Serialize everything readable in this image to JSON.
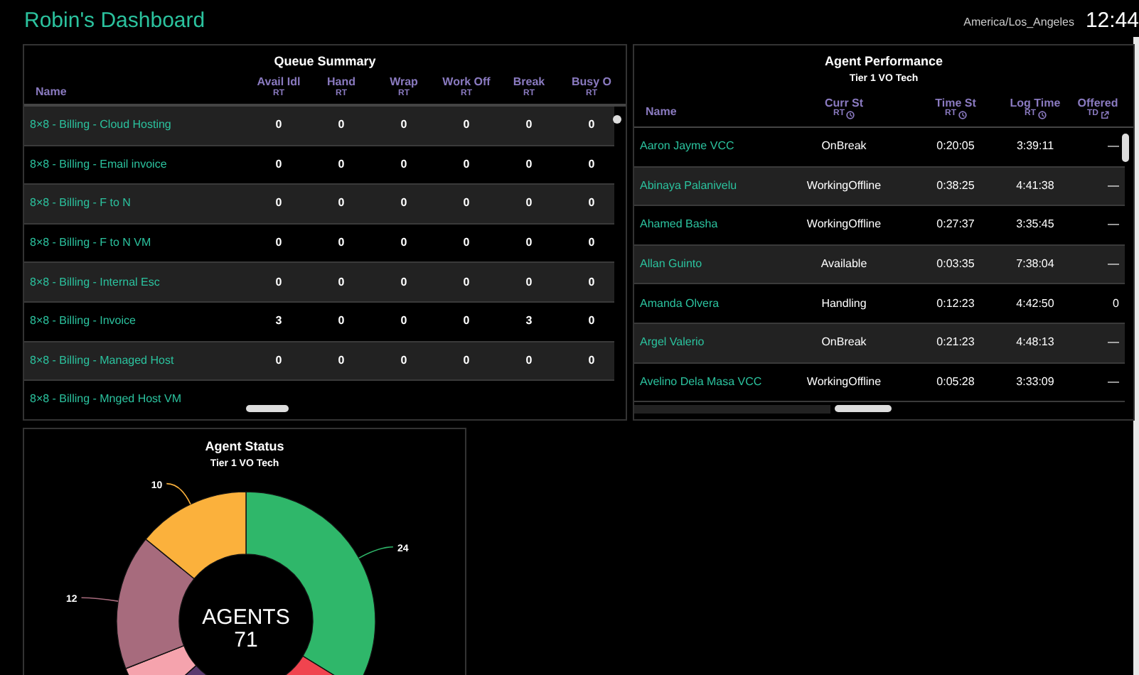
{
  "header": {
    "title": "Robin's Dashboard",
    "timezone": "America/Los_Angeles",
    "clock": "12:44"
  },
  "queue_summary": {
    "title": "Queue Summary",
    "columns": [
      {
        "label": "Name"
      },
      {
        "label": "Avail Idl",
        "sub": "RT"
      },
      {
        "label": "Hand",
        "sub": "RT"
      },
      {
        "label": "Wrap",
        "sub": "RT"
      },
      {
        "label": "Work Off",
        "sub": "RT"
      },
      {
        "label": "Break",
        "sub": "RT"
      },
      {
        "label": "Busy O",
        "sub": "RT"
      }
    ],
    "rows": [
      {
        "cells": [
          "8×8 - Billing - Cloud Hosting",
          "0",
          "0",
          "0",
          "0",
          "0",
          "0"
        ]
      },
      {
        "cells": [
          "8×8 - Billing - Email invoice",
          "0",
          "0",
          "0",
          "0",
          "0",
          "0"
        ]
      },
      {
        "cells": [
          "8×8 - Billing - F to N",
          "0",
          "0",
          "0",
          "0",
          "0",
          "0"
        ]
      },
      {
        "cells": [
          "8×8 - Billing - F to N VM",
          "0",
          "0",
          "0",
          "0",
          "0",
          "0"
        ]
      },
      {
        "cells": [
          "8×8 - Billing - Internal Esc",
          "0",
          "0",
          "0",
          "0",
          "0",
          "0"
        ]
      },
      {
        "cells": [
          "8×8 - Billing - Invoice",
          "3",
          "0",
          "0",
          "0",
          "3",
          "0"
        ]
      },
      {
        "cells": [
          "8×8 - Billing - Managed Host",
          "0",
          "0",
          "0",
          "0",
          "0",
          "0"
        ]
      },
      {
        "cells": [
          "8×8 - Billing - Mnged Host VM"
        ]
      }
    ]
  },
  "agent_performance": {
    "title": "Agent Performance",
    "subtitle": "Tier 1 VO Tech",
    "columns": [
      {
        "label": "Name"
      },
      {
        "label": "Curr St",
        "sub": "RT"
      },
      {
        "label": "Time St",
        "sub": "RT"
      },
      {
        "label": "Log Time",
        "sub": "RT"
      },
      {
        "label": "Offered",
        "sub": "TD"
      }
    ],
    "rows": [
      {
        "cells": [
          "Aaron Jayme VCC",
          "OnBreak",
          "0:20:05",
          "3:39:11",
          "—"
        ]
      },
      {
        "cells": [
          "Abinaya Palanivelu",
          "WorkingOffline",
          "0:38:25",
          "4:41:38",
          "—"
        ]
      },
      {
        "cells": [
          "Ahamed Basha",
          "WorkingOffline",
          "0:27:37",
          "3:35:45",
          "—"
        ]
      },
      {
        "cells": [
          "Allan Guinto",
          "Available",
          "0:03:35",
          "7:38:04",
          "—"
        ]
      },
      {
        "cells": [
          "Amanda Olvera",
          "Handling",
          "0:12:23",
          "4:42:50",
          "0"
        ]
      },
      {
        "cells": [
          "Argel Valerio",
          "OnBreak",
          "0:21:23",
          "4:48:13",
          "—"
        ]
      },
      {
        "cells": [
          "Avelino Dela Masa VCC",
          "WorkingOffline",
          "0:05:28",
          "3:33:09",
          "—"
        ]
      }
    ]
  },
  "agent_status": {
    "title": "Agent Status",
    "subtitle": "Tier 1 VO Tech",
    "center_label": "AGENTS",
    "center_value": "71",
    "segments": [
      {
        "color": "#2fb76a",
        "label": "24"
      },
      {
        "color": "#f0444f"
      },
      {
        "color": "#5a3a6e"
      },
      {
        "color": "#f5a3ad"
      },
      {
        "color": "#a76b7d",
        "label": "12"
      },
      {
        "color": "#fbb13c",
        "label": "10"
      }
    ]
  }
}
